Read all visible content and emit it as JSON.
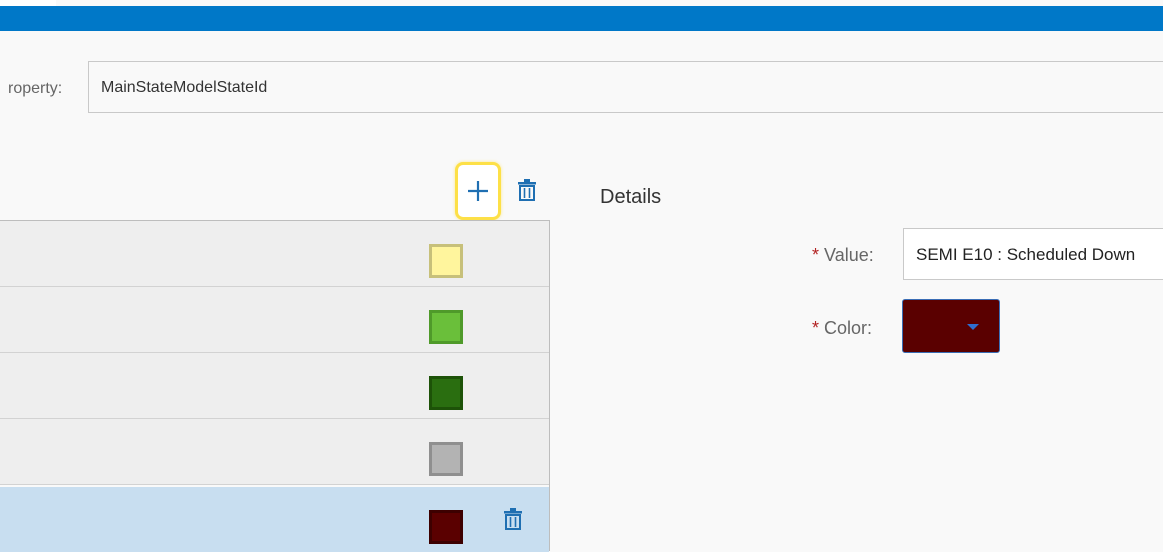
{
  "property": {
    "label": "roperty:",
    "value": "MainStateModelStateId"
  },
  "toolbar": {
    "add_icon": "plus-icon",
    "delete_icon": "trash-icon"
  },
  "details": {
    "title": "Details",
    "value_label": "Value:",
    "value": "SEMI E10 : Scheduled Down",
    "color_label": "Color:",
    "color": "#5a0000",
    "required_mark": "*"
  },
  "list": {
    "rows": [
      {
        "swatch_fill": "#fff59d",
        "swatch_border": "#c7c07a"
      },
      {
        "swatch_fill": "#6abf3a",
        "swatch_border": "#4f9a2a"
      },
      {
        "swatch_fill": "#2a6e10",
        "swatch_border": "#1d5208"
      },
      {
        "swatch_fill": "#b3b3b3",
        "swatch_border": "#8f8f8f"
      },
      {
        "swatch_fill": "#5a0000",
        "swatch_border": "#3d0000",
        "selected": true
      }
    ]
  },
  "colors": {
    "accent": "#0078c8",
    "highlight": "#fde047",
    "selected_row": "#c8def0"
  }
}
